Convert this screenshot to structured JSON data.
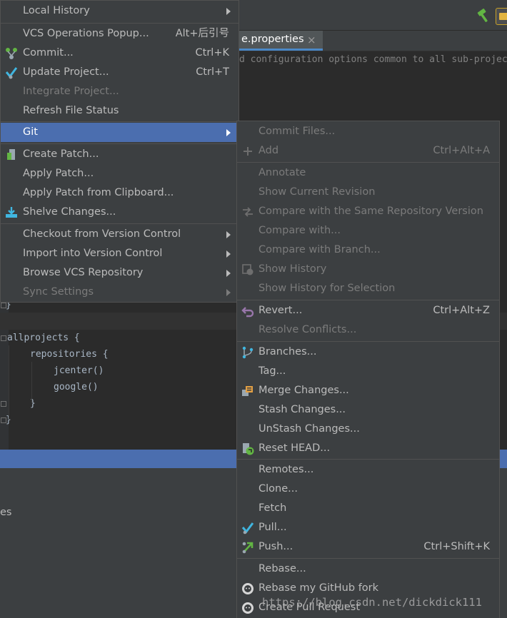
{
  "editor": {
    "tab_label": "e.properties",
    "tab_close": "×",
    "comment_line": "d configuration options common to all sub-projec",
    "code": {
      "brace_close_1": "}",
      "allprojects": "allprojects {",
      "repositories": "repositories {",
      "jcenter": "jcenter()",
      "google": "google()",
      "brace_inner": "}",
      "brace_close_2": "}"
    },
    "bottom_text": "es"
  },
  "vcs_menu": {
    "items": [
      {
        "label": "Local History"
      },
      {
        "label": "VCS Operations Popup...",
        "shortcut": "Alt+后引号"
      },
      {
        "label": "Commit...",
        "shortcut": "Ctrl+K",
        "icon": "commit-icon"
      },
      {
        "label": "Update Project...",
        "shortcut": "Ctrl+T",
        "icon": "update-project-icon"
      },
      {
        "label": "Integrate Project..."
      },
      {
        "label": "Refresh File Status"
      },
      {
        "label": "Git"
      },
      {
        "label": "Create Patch...",
        "icon": "create-patch-icon"
      },
      {
        "label": "Apply Patch..."
      },
      {
        "label": "Apply Patch from Clipboard..."
      },
      {
        "label": "Shelve Changes...",
        "icon": "shelve-icon"
      },
      {
        "label": "Checkout from Version Control"
      },
      {
        "label": "Import into Version Control"
      },
      {
        "label": "Browse VCS Repository"
      },
      {
        "label": "Sync Settings"
      }
    ]
  },
  "git_menu": {
    "items": [
      {
        "label": "Commit Files..."
      },
      {
        "label": "Add",
        "shortcut": "Ctrl+Alt+A",
        "icon": "add-icon"
      },
      {
        "label": "Annotate"
      },
      {
        "label": "Show Current Revision"
      },
      {
        "label": "Compare with the Same Repository Version",
        "icon": "compare-icon"
      },
      {
        "label": "Compare with..."
      },
      {
        "label": "Compare with Branch..."
      },
      {
        "label": "Show History",
        "icon": "history-icon"
      },
      {
        "label": "Show History for Selection"
      },
      {
        "label": "Revert...",
        "shortcut": "Ctrl+Alt+Z",
        "icon": "revert-icon"
      },
      {
        "label": "Resolve Conflicts..."
      },
      {
        "label": "Branches...",
        "icon": "branches-icon"
      },
      {
        "label": "Tag..."
      },
      {
        "label": "Merge Changes...",
        "icon": "merge-icon"
      },
      {
        "label": "Stash Changes..."
      },
      {
        "label": "UnStash Changes..."
      },
      {
        "label": "Reset HEAD...",
        "icon": "reset-head-icon"
      },
      {
        "label": "Remotes..."
      },
      {
        "label": "Clone..."
      },
      {
        "label": "Fetch"
      },
      {
        "label": "Pull...",
        "icon": "pull-icon"
      },
      {
        "label": "Push...",
        "shortcut": "Ctrl+Shift+K",
        "icon": "push-icon"
      },
      {
        "label": "Rebase..."
      },
      {
        "label": "Rebase my GitHub fork",
        "icon": "github-icon"
      },
      {
        "label": "Create Pull Request",
        "icon": "github-icon"
      }
    ]
  },
  "watermark": "https://blog.csdn.net/dickdick111",
  "colors": {
    "menu_bg": "#3c3f41",
    "selection": "#4b6eaf",
    "text": "#bbbbbb",
    "disabled_text": "#7b7b7b",
    "editor_bg": "#2b2b2b"
  }
}
